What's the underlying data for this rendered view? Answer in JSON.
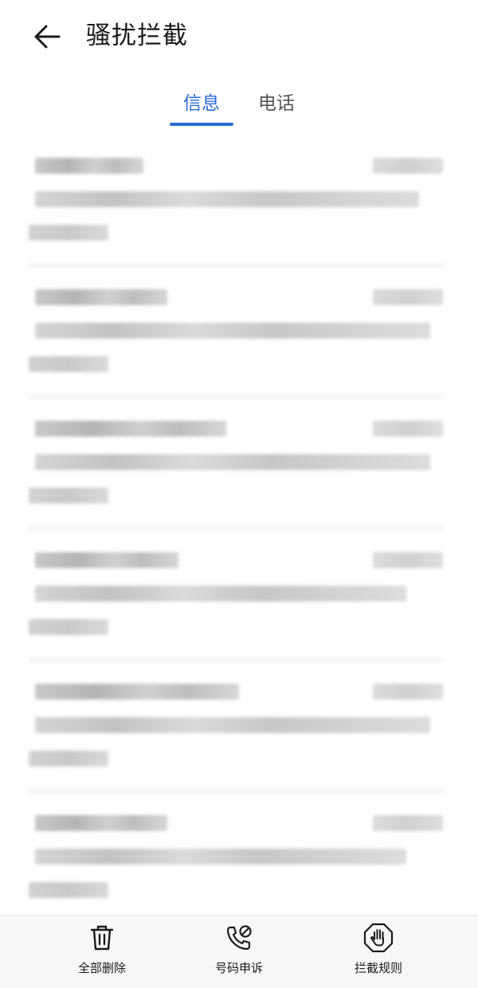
{
  "header": {
    "back_icon": "arrow-left-icon",
    "title": "骚扰拦截"
  },
  "tabs": [
    {
      "label": "信息",
      "active": true
    },
    {
      "label": "电话",
      "active": false
    }
  ],
  "colors": {
    "accent": "#2b6cd4",
    "text_primary": "#1a1a1a",
    "text_secondary": "#555555",
    "bottom_bar_bg": "#f7f7f7"
  },
  "messages_note": "blurred",
  "bottom_actions": [
    {
      "label": "全部删除",
      "icon": "trash-icon"
    },
    {
      "label": "号码申诉",
      "icon": "phone-appeal-icon"
    },
    {
      "label": "拦截规则",
      "icon": "hand-stop-icon"
    }
  ]
}
